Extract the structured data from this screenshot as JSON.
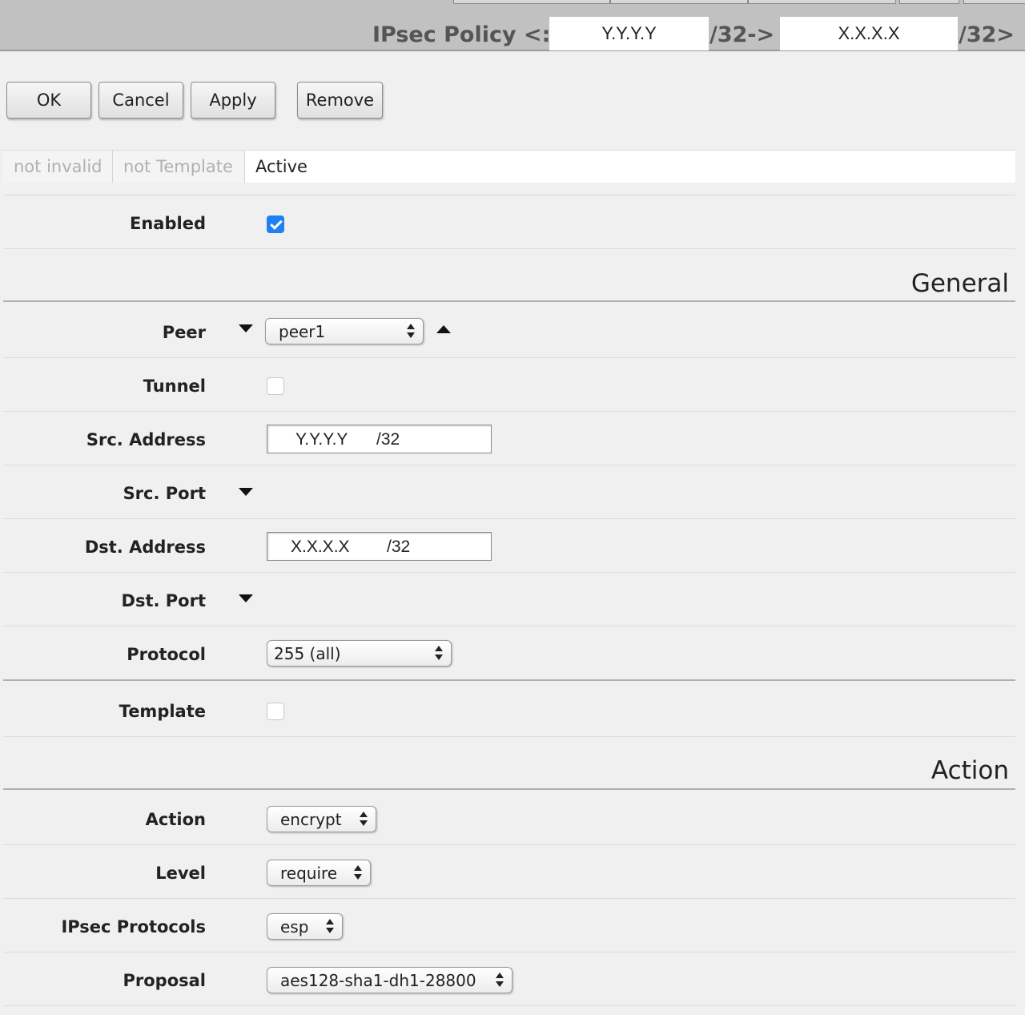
{
  "title": {
    "prefix": "IPsec Policy <:",
    "src_address": "Y.Y.Y.Y",
    "mid": "/32->",
    "dst_address": "X.X.X.X",
    "suffix": "/32>"
  },
  "toolbar": {
    "ok_label": "OK",
    "cancel_label": "Cancel",
    "apply_label": "Apply",
    "remove_label": "Remove"
  },
  "status": {
    "invalid": "not invalid",
    "template": "not Template",
    "active": "Active"
  },
  "sections": {
    "general": "General",
    "action": "Action"
  },
  "fields": {
    "enabled": {
      "label": "Enabled",
      "checked": true
    },
    "peer": {
      "label": "Peer",
      "value": "peer1"
    },
    "tunnel": {
      "label": "Tunnel",
      "checked": false
    },
    "src_address": {
      "label": "Src. Address",
      "ip": "Y.Y.Y.Y",
      "mask": "/32"
    },
    "src_port": {
      "label": "Src. Port"
    },
    "dst_address": {
      "label": "Dst. Address",
      "ip": "X.X.X.X",
      "mask": "/32"
    },
    "dst_port": {
      "label": "Dst. Port"
    },
    "protocol": {
      "label": "Protocol",
      "value": "255 (all)"
    },
    "template": {
      "label": "Template",
      "checked": false
    },
    "action": {
      "label": "Action",
      "value": "encrypt"
    },
    "level": {
      "label": "Level",
      "value": "require"
    },
    "ipsec_protocols": {
      "label": "IPsec Protocols",
      "value": "esp"
    },
    "proposal": {
      "label": "Proposal",
      "value": "aes128-sha1-dh1-28800"
    }
  },
  "colors": {
    "titlebar": "#c1c1c1",
    "background": "#f0f0f0",
    "checkbox_checked": "#1f7ff5"
  }
}
